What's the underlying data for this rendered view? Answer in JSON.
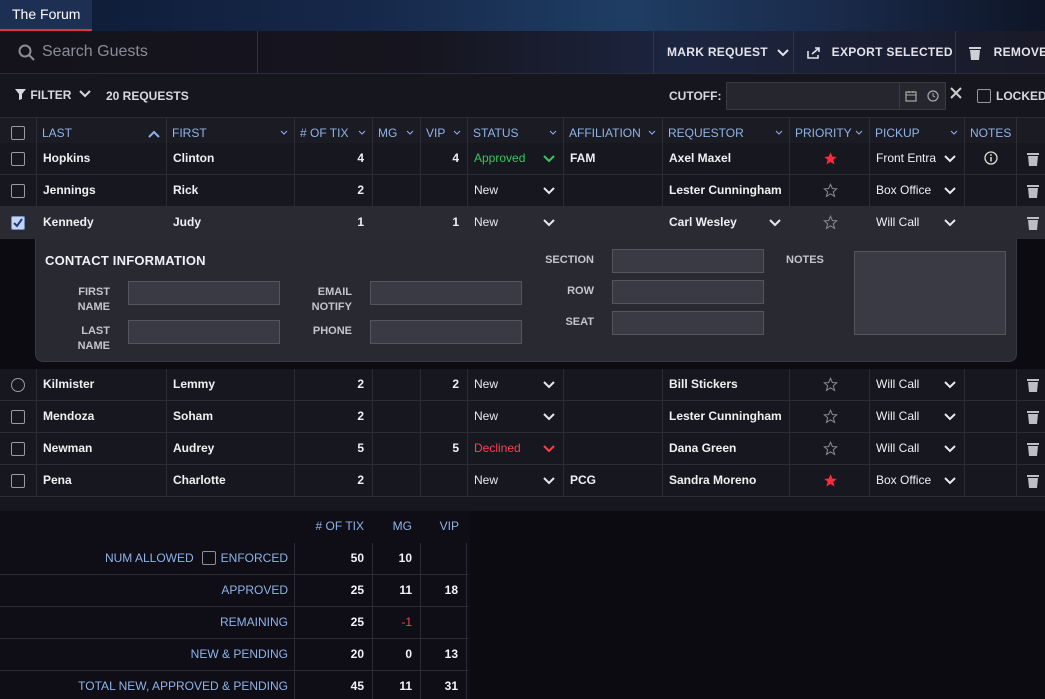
{
  "app": {
    "tab": "The Forum"
  },
  "toolbar": {
    "search_placeholder": "Search Guests",
    "mark_request": "MARK REQUEST",
    "export_selected": "EXPORT SELECTED",
    "remove": "REMOVE"
  },
  "filterbar": {
    "filter": "FILTER",
    "count": "20 REQUESTS",
    "cutoff": "CUTOFF:",
    "locked": "LOCKED"
  },
  "columns": {
    "last": "LAST",
    "first": "FIRST",
    "tix": "# OF TIX",
    "mg": "MG",
    "vip": "VIP",
    "status": "STATUS",
    "affiliation": "AFFILIATION",
    "requestor": "REQUESTOR",
    "priority": "PRIORITY",
    "pickup": "PICKUP",
    "notes": "NOTES"
  },
  "rows": [
    {
      "last": "Hopkins",
      "first": "Clinton",
      "tix": "4",
      "mg": "",
      "vip": "4",
      "status": "Approved",
      "affiliation": "FAM",
      "requestor": "Axel Maxel",
      "priority": true,
      "pickup": "Front Entra",
      "notes": true,
      "checked": false
    },
    {
      "last": "Jennings",
      "first": "Rick",
      "tix": "2",
      "mg": "",
      "vip": "",
      "status": "New",
      "affiliation": "",
      "requestor": "Lester Cunningham",
      "priority": false,
      "pickup": "Box Office",
      "checked": false
    },
    {
      "last": "Kennedy",
      "first": "Judy",
      "tix": "1",
      "mg": "",
      "vip": "1",
      "status": "New",
      "affiliation": "",
      "requestor": "Carl Wesley",
      "priority": false,
      "pickup": "Will Call",
      "checked": true
    },
    {
      "last": "Kilmister",
      "first": "Lemmy",
      "tix": "2",
      "mg": "",
      "vip": "2",
      "status": "New",
      "affiliation": "",
      "requestor": "Bill Stickers",
      "priority": false,
      "pickup": "Will Call",
      "checked": false
    },
    {
      "last": "Mendoza",
      "first": "Soham",
      "tix": "2",
      "mg": "",
      "vip": "",
      "status": "New",
      "affiliation": "",
      "requestor": "Lester Cunningham",
      "priority": false,
      "pickup": "Will Call",
      "checked": false
    },
    {
      "last": "Newman",
      "first": "Audrey",
      "tix": "5",
      "mg": "",
      "vip": "5",
      "status": "Declined",
      "affiliation": "",
      "requestor": "Dana Green",
      "priority": false,
      "pickup": "Will Call",
      "checked": false
    },
    {
      "last": "Pena",
      "first": "Charlotte",
      "tix": "2",
      "mg": "",
      "vip": "",
      "status": "New",
      "affiliation": "PCG",
      "requestor": "Sandra Moreno",
      "priority": true,
      "pickup": "Box Office",
      "checked": false
    }
  ],
  "contact": {
    "title": "CONTACT INFORMATION",
    "first_name": "FIRST NAME",
    "last_name": "LAST NAME",
    "email_notify": "EMAIL NOTIFY",
    "phone": "PHONE",
    "section": "SECTION",
    "row": "ROW",
    "seat": "SEAT",
    "notes": "NOTES"
  },
  "summary": {
    "headers": {
      "tix": "# OF TIX",
      "mg": "MG",
      "vip": "VIP"
    },
    "enforced": "ENFORCED",
    "rows": [
      {
        "label": "NUM ALLOWED",
        "tix": "50",
        "mg": "10",
        "vip": ""
      },
      {
        "label": "APPROVED",
        "tix": "25",
        "mg": "11",
        "vip": "18"
      },
      {
        "label": "REMAINING",
        "tix": "25",
        "mg": "-1",
        "vip": ""
      },
      {
        "label": "NEW & PENDING",
        "tix": "20",
        "mg": "0",
        "vip": "13"
      },
      {
        "label": "TOTAL NEW, APPROVED & PENDING",
        "tix": "45",
        "mg": "11",
        "vip": "31"
      }
    ]
  },
  "colors": {
    "approved": "#36c95b",
    "declined": "#ff3e4d",
    "star": "#ff2a3c",
    "header_text": "#8fb3e8"
  }
}
